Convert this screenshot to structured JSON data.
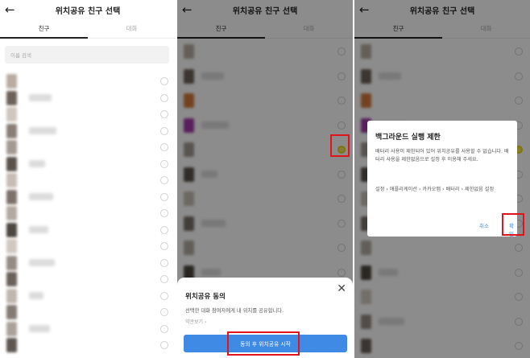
{
  "panels": {
    "friends": {
      "back": "←",
      "title": "위치공유 친구 선택",
      "tab_friends": "친구",
      "tab_chats": "대화",
      "search_placeholder": "이름 검색"
    },
    "consent": {
      "back": "←",
      "title": "위치공유 친구 선택",
      "tab_friends": "친구",
      "tab_chats": "대화",
      "sheet": {
        "title": "위치공유 동의",
        "close": "✕",
        "description": "선택한 대화 참여자에게 내 위치를 공유합니다.",
        "terms_link": "약관보기 ›",
        "confirm_button": "동의 후 위치공유 시작"
      }
    },
    "restriction": {
      "back": "←",
      "title": "위치공유 친구 선택",
      "tab_friends": "친구",
      "tab_chats": "대화",
      "dialog": {
        "title": "백그라운드 실행 제한",
        "body": "배터리 사용이 제한되어 있어 위치공유를 사용할 수 없습니다. 배터리 사용을 제한없음으로 설정 후 이용해 주세요.",
        "path": "설정 › 애플리케이션 › 카카오맵 › 배터리 › 제한없음 설정",
        "cancel": "취소",
        "ok": "확인"
      }
    }
  },
  "colors": {
    "accent_blue": "#3e8ae4",
    "highlight_red": "#e0141a",
    "selected_radio": "#f6e65a"
  },
  "icons": {
    "back": "arrow-left-icon",
    "close": "close-icon",
    "radio": "radio-button-icon"
  }
}
